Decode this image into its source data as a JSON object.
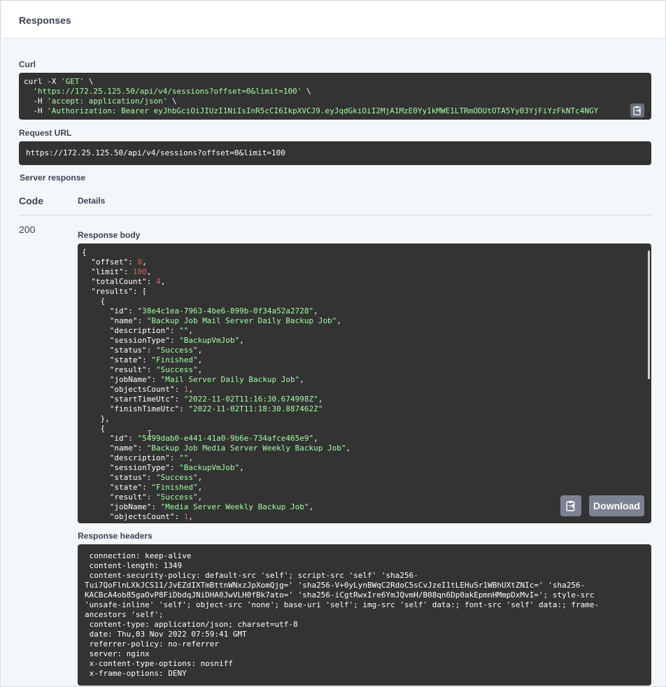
{
  "header": {
    "title": "Responses"
  },
  "curl": {
    "label": "Curl",
    "lines": [
      {
        "plain": "curl -X ",
        "str": "'GET'",
        "tail": " \\"
      },
      {
        "plain": "  ",
        "str": "'https://172.25.125.50/api/v4/sessions?offset=0&limit=100'",
        "tail": " \\"
      },
      {
        "plain": "  -H ",
        "str": "'accept: application/json'",
        "tail": " \\"
      },
      {
        "plain": "  -H ",
        "str": "'Authorization: Bearer eyJhbGciOiJIUzI1NiIsInR5cCI6IkpXVCJ9.eyJqdGkiOiI2MjA1MzE0Yy1kMWE1LTRmODUtOTA5Yy03YjFiYzFkNTc4NGY",
        "tail": ""
      }
    ]
  },
  "request_url": {
    "label": "Request URL",
    "value": "https://172.25.125.50/api/v4/sessions?offset=0&limit=100"
  },
  "server_response": {
    "label": "Server response",
    "code_header": "Code",
    "details_header": "Details",
    "code": "200",
    "response_body_label": "Response body",
    "response_headers_label": "Response headers",
    "download_label": "Download"
  },
  "response_body": {
    "lines": [
      [
        {
          "t": "p",
          "v": "{"
        }
      ],
      [
        {
          "t": "p",
          "v": "  \"offset\": "
        },
        {
          "t": "n",
          "v": "0"
        },
        {
          "t": "p",
          "v": ","
        }
      ],
      [
        {
          "t": "p",
          "v": "  \"limit\": "
        },
        {
          "t": "n",
          "v": "100"
        },
        {
          "t": "p",
          "v": ","
        }
      ],
      [
        {
          "t": "p",
          "v": "  \"totalCount\": "
        },
        {
          "t": "n",
          "v": "4"
        },
        {
          "t": "p",
          "v": ","
        }
      ],
      [
        {
          "t": "p",
          "v": "  \"results\": ["
        }
      ],
      [
        {
          "t": "p",
          "v": "    {"
        }
      ],
      [
        {
          "t": "p",
          "v": "      \"id\": "
        },
        {
          "t": "s",
          "v": "\"38e4c1ea-7963-4be6-899b-0f34a52a2728\""
        },
        {
          "t": "p",
          "v": ","
        }
      ],
      [
        {
          "t": "p",
          "v": "      \"name\": "
        },
        {
          "t": "s",
          "v": "\"Backup Job Mail Server Daily Backup Job\""
        },
        {
          "t": "p",
          "v": ","
        }
      ],
      [
        {
          "t": "p",
          "v": "      \"description\": "
        },
        {
          "t": "s",
          "v": "\"\""
        },
        {
          "t": "p",
          "v": ","
        }
      ],
      [
        {
          "t": "p",
          "v": "      \"sessionType\": "
        },
        {
          "t": "s",
          "v": "\"BackupVmJob\""
        },
        {
          "t": "p",
          "v": ","
        }
      ],
      [
        {
          "t": "p",
          "v": "      \"status\": "
        },
        {
          "t": "s",
          "v": "\"Success\""
        },
        {
          "t": "p",
          "v": ","
        }
      ],
      [
        {
          "t": "p",
          "v": "      \"state\": "
        },
        {
          "t": "s",
          "v": "\"Finished\""
        },
        {
          "t": "p",
          "v": ","
        }
      ],
      [
        {
          "t": "p",
          "v": "      \"result\": "
        },
        {
          "t": "s",
          "v": "\"Success\""
        },
        {
          "t": "p",
          "v": ","
        }
      ],
      [
        {
          "t": "p",
          "v": "      \"jobName\": "
        },
        {
          "t": "s",
          "v": "\"Mail Server Daily Backup Job\""
        },
        {
          "t": "p",
          "v": ","
        }
      ],
      [
        {
          "t": "p",
          "v": "      \"objectsCount\": "
        },
        {
          "t": "n",
          "v": "1"
        },
        {
          "t": "p",
          "v": ","
        }
      ],
      [
        {
          "t": "p",
          "v": "      \"startTimeUtc\": "
        },
        {
          "t": "s",
          "v": "\"2022-11-02T11:16:30.674998Z\""
        },
        {
          "t": "p",
          "v": ","
        }
      ],
      [
        {
          "t": "p",
          "v": "      \"finishTimeUtc\": "
        },
        {
          "t": "s",
          "v": "\"2022-11-02T11:18:30.887462Z\""
        }
      ],
      [
        {
          "t": "p",
          "v": "    },"
        }
      ],
      [
        {
          "t": "p",
          "v": "    {"
        }
      ],
      [
        {
          "t": "p",
          "v": "      \"id\": "
        },
        {
          "t": "s",
          "v": "\"5499dab0-e441-41a0-9b6e-734afce465e9\""
        },
        {
          "t": "p",
          "v": ","
        }
      ],
      [
        {
          "t": "p",
          "v": "      \"name\": "
        },
        {
          "t": "s",
          "v": "\"Backup Job Media Server Weekly Backup Job\""
        },
        {
          "t": "p",
          "v": ","
        }
      ],
      [
        {
          "t": "p",
          "v": "      \"description\": "
        },
        {
          "t": "s",
          "v": "\"\""
        },
        {
          "t": "p",
          "v": ","
        }
      ],
      [
        {
          "t": "p",
          "v": "      \"sessionType\": "
        },
        {
          "t": "s",
          "v": "\"BackupVmJob\""
        },
        {
          "t": "p",
          "v": ","
        }
      ],
      [
        {
          "t": "p",
          "v": "      \"status\": "
        },
        {
          "t": "s",
          "v": "\"Success\""
        },
        {
          "t": "p",
          "v": ","
        }
      ],
      [
        {
          "t": "p",
          "v": "      \"state\": "
        },
        {
          "t": "s",
          "v": "\"Finished\""
        },
        {
          "t": "p",
          "v": ","
        }
      ],
      [
        {
          "t": "p",
          "v": "      \"result\": "
        },
        {
          "t": "s",
          "v": "\"Success\""
        },
        {
          "t": "p",
          "v": ","
        }
      ],
      [
        {
          "t": "p",
          "v": "      \"jobName\": "
        },
        {
          "t": "s",
          "v": "\"Media Server Weekly Backup Job\""
        },
        {
          "t": "p",
          "v": ","
        }
      ],
      [
        {
          "t": "p",
          "v": "      \"objectsCount\": "
        },
        {
          "t": "n",
          "v": "1"
        },
        {
          "t": "p",
          "v": ","
        }
      ]
    ]
  },
  "response_headers": {
    "lines": [
      " connection: keep-alive",
      " content-length: 1349",
      " content-security-policy: default-src 'self'; script-src 'self' 'sha256-",
      "Tui7QoFlnLXkJCS11/JvEZdIXTmBttnWNxzJpXomQjg=' 'sha256-V+0yLynBWqC2RdoC5sCvJzeI1tLEHuSr1WBhUXtZNIc=' 'sha256-",
      "KACBcA4ob85gaOvP8FiDbdqJNiDHA0JwVLH0fBk7ato=' 'sha256-iCgtRwxIre6YmJQvmH/B08qn6Dp0akEpmnHMmpDxMvI='; style-src",
      "'unsafe-inline' 'self'; object-src 'none'; base-uri 'self'; img-src 'self' data:; font-src 'self' data:; frame-",
      "ancestors 'self';",
      " content-type: application/json; charset=utf-8",
      " date: Thu,03 Nov 2022 07:59:41 GMT",
      " referrer-policy: no-referrer",
      " server: nginx",
      " x-content-type-options: nosniff",
      " x-frame-options: DENY"
    ]
  },
  "icons": {
    "copy": "clipboard-icon",
    "text_cursor": "text-cursor-icon"
  }
}
